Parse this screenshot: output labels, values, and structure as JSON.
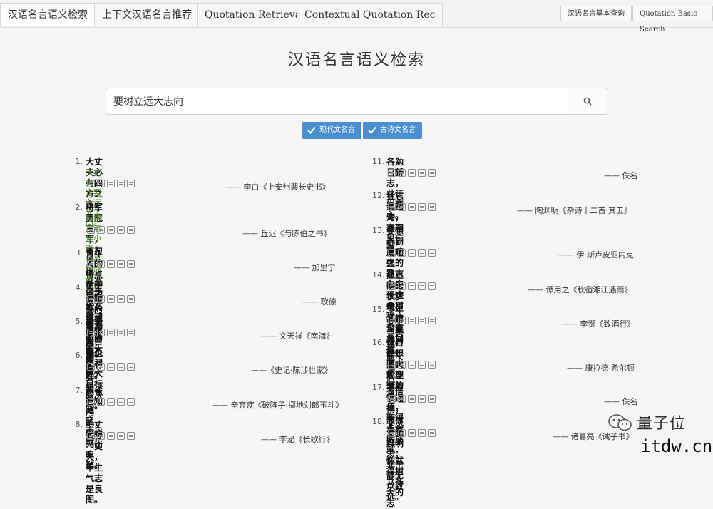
{
  "tabs": [
    "汉语名言语义检索",
    "上下文汉语名言推荐",
    "Quotation Retrieval",
    "Contextual Quotation Rec"
  ],
  "right_tabs": [
    "汉语名言基本查询",
    "Quotation Basic Search"
  ],
  "page_title": "汉语名言语义检索",
  "search": {
    "value": "要树立远大志向",
    "icon": "search-icon"
  },
  "filters": [
    "现代文名言",
    "古诗文名言"
  ],
  "left_results": [
    {
      "num": "1.",
      "quote": "大丈夫必有四方之志。",
      "translation": "大丈夫一定要有远大志向。",
      "source": "—— 李白《上安州裴长史书》"
    },
    {
      "num": "2.",
      "quote": "将军勇冠三军，才为世出，弃燕雀之小志，慕鸿鹄以高翔!",
      "translation": "您摈弃燕雀小志，仰慕鸿鹄高飞的远大抱负。",
      "source": "—— 丘迟《与陈伯之书》"
    },
    {
      "num": "3.",
      "quote": "青年人的特点在于他们抱有做理想事业的宏大志愿。",
      "source": "—— 加里宁"
    },
    {
      "num": "4.",
      "quote": "人生最重要的是要有伟大目标及达到伟大目标的决心。",
      "source": "—— 歌德"
    },
    {
      "num": "5.",
      "quote": "男子千年志，吾生未有涯。",
      "source": "—— 文天祥《南海》"
    },
    {
      "num": "6.",
      "quote": "燕雀安知鸿鹄之志哉!",
      "source": "——《史记·陈涉世家》"
    },
    {
      "num": "7.",
      "quote": "燕雀岂知鸿鹄，貂蝉元出兜鍪。",
      "source": "—— 辛弃疾《破阵子·掷地刘郎玉斗》"
    },
    {
      "num": "8.",
      "quote": "一丈夫兮一丈夫，千生气志是良图。",
      "source": "—— 李泌《长歌行》"
    }
  ],
  "right_results": [
    {
      "num": "11.",
      "quote": "各勉日新志，共证岁寒心。",
      "source": "—— 佚名"
    },
    {
      "num": "12.",
      "quote": "猛志逸四海，骞翮思远翥。",
      "source": "—— 陶渊明《杂诗十二首·其五》"
    },
    {
      "num": "13.",
      "quote": "要想走到成功之路，心中一定要树立一个奋斗目标，要下决心，有信",
      "quote2": "心，用顽强的意志去实现这个目标。",
      "source": "—— 伊·斯卢皮亚内克"
    },
    {
      "num": "14.",
      "quote": "江上阴云锁梦魂，江边深夜舞刘琨。",
      "source": "—— 谭用之《秋宿湘江遇雨》"
    },
    {
      "num": "15.",
      "quote": "少年心事当拏云。",
      "source": "—— 李贺《致酒行》"
    },
    {
      "num": "16.",
      "quote": "你自己想要实现多大的价值，取得多大的成就，你就得树立多大的志",
      "quote2": "向，多大的理想。",
      "source": "—— 康拉德·希尔顿"
    },
    {
      "num": "17.",
      "quote": "书应读通彻，志当存高远。",
      "source": "—— 佚名"
    },
    {
      "num": "18.",
      "quote": "非淡泊无以明志，非宁静无以致远。",
      "source": "—— 诸葛亮《诫子书》"
    }
  ],
  "watermark": {
    "text": "量子位",
    "url": "itdw.cn",
    "icon": "wechat-icon"
  },
  "colors": {
    "accent": "#4a8fd0",
    "translation": "#4f8a2a"
  }
}
